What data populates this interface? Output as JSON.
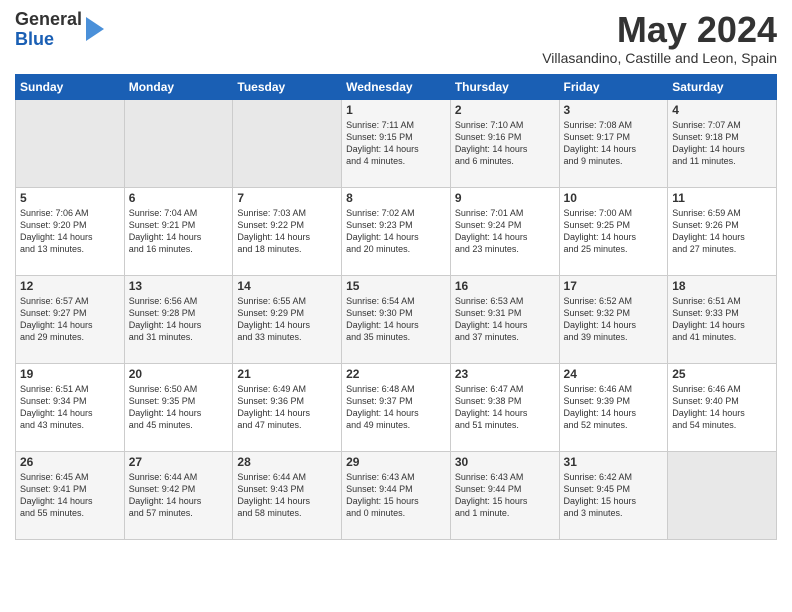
{
  "header": {
    "logo_general": "General",
    "logo_blue": "Blue",
    "title": "May 2024",
    "location": "Villasandino, Castille and Leon, Spain"
  },
  "weekdays": [
    "Sunday",
    "Monday",
    "Tuesday",
    "Wednesday",
    "Thursday",
    "Friday",
    "Saturday"
  ],
  "weeks": [
    [
      {
        "day": "",
        "content": ""
      },
      {
        "day": "",
        "content": ""
      },
      {
        "day": "",
        "content": ""
      },
      {
        "day": "1",
        "content": "Sunrise: 7:11 AM\nSunset: 9:15 PM\nDaylight: 14 hours\nand 4 minutes."
      },
      {
        "day": "2",
        "content": "Sunrise: 7:10 AM\nSunset: 9:16 PM\nDaylight: 14 hours\nand 6 minutes."
      },
      {
        "day": "3",
        "content": "Sunrise: 7:08 AM\nSunset: 9:17 PM\nDaylight: 14 hours\nand 9 minutes."
      },
      {
        "day": "4",
        "content": "Sunrise: 7:07 AM\nSunset: 9:18 PM\nDaylight: 14 hours\nand 11 minutes."
      }
    ],
    [
      {
        "day": "5",
        "content": "Sunrise: 7:06 AM\nSunset: 9:20 PM\nDaylight: 14 hours\nand 13 minutes."
      },
      {
        "day": "6",
        "content": "Sunrise: 7:04 AM\nSunset: 9:21 PM\nDaylight: 14 hours\nand 16 minutes."
      },
      {
        "day": "7",
        "content": "Sunrise: 7:03 AM\nSunset: 9:22 PM\nDaylight: 14 hours\nand 18 minutes."
      },
      {
        "day": "8",
        "content": "Sunrise: 7:02 AM\nSunset: 9:23 PM\nDaylight: 14 hours\nand 20 minutes."
      },
      {
        "day": "9",
        "content": "Sunrise: 7:01 AM\nSunset: 9:24 PM\nDaylight: 14 hours\nand 23 minutes."
      },
      {
        "day": "10",
        "content": "Sunrise: 7:00 AM\nSunset: 9:25 PM\nDaylight: 14 hours\nand 25 minutes."
      },
      {
        "day": "11",
        "content": "Sunrise: 6:59 AM\nSunset: 9:26 PM\nDaylight: 14 hours\nand 27 minutes."
      }
    ],
    [
      {
        "day": "12",
        "content": "Sunrise: 6:57 AM\nSunset: 9:27 PM\nDaylight: 14 hours\nand 29 minutes."
      },
      {
        "day": "13",
        "content": "Sunrise: 6:56 AM\nSunset: 9:28 PM\nDaylight: 14 hours\nand 31 minutes."
      },
      {
        "day": "14",
        "content": "Sunrise: 6:55 AM\nSunset: 9:29 PM\nDaylight: 14 hours\nand 33 minutes."
      },
      {
        "day": "15",
        "content": "Sunrise: 6:54 AM\nSunset: 9:30 PM\nDaylight: 14 hours\nand 35 minutes."
      },
      {
        "day": "16",
        "content": "Sunrise: 6:53 AM\nSunset: 9:31 PM\nDaylight: 14 hours\nand 37 minutes."
      },
      {
        "day": "17",
        "content": "Sunrise: 6:52 AM\nSunset: 9:32 PM\nDaylight: 14 hours\nand 39 minutes."
      },
      {
        "day": "18",
        "content": "Sunrise: 6:51 AM\nSunset: 9:33 PM\nDaylight: 14 hours\nand 41 minutes."
      }
    ],
    [
      {
        "day": "19",
        "content": "Sunrise: 6:51 AM\nSunset: 9:34 PM\nDaylight: 14 hours\nand 43 minutes."
      },
      {
        "day": "20",
        "content": "Sunrise: 6:50 AM\nSunset: 9:35 PM\nDaylight: 14 hours\nand 45 minutes."
      },
      {
        "day": "21",
        "content": "Sunrise: 6:49 AM\nSunset: 9:36 PM\nDaylight: 14 hours\nand 47 minutes."
      },
      {
        "day": "22",
        "content": "Sunrise: 6:48 AM\nSunset: 9:37 PM\nDaylight: 14 hours\nand 49 minutes."
      },
      {
        "day": "23",
        "content": "Sunrise: 6:47 AM\nSunset: 9:38 PM\nDaylight: 14 hours\nand 51 minutes."
      },
      {
        "day": "24",
        "content": "Sunrise: 6:46 AM\nSunset: 9:39 PM\nDaylight: 14 hours\nand 52 minutes."
      },
      {
        "day": "25",
        "content": "Sunrise: 6:46 AM\nSunset: 9:40 PM\nDaylight: 14 hours\nand 54 minutes."
      }
    ],
    [
      {
        "day": "26",
        "content": "Sunrise: 6:45 AM\nSunset: 9:41 PM\nDaylight: 14 hours\nand 55 minutes."
      },
      {
        "day": "27",
        "content": "Sunrise: 6:44 AM\nSunset: 9:42 PM\nDaylight: 14 hours\nand 57 minutes."
      },
      {
        "day": "28",
        "content": "Sunrise: 6:44 AM\nSunset: 9:43 PM\nDaylight: 14 hours\nand 58 minutes."
      },
      {
        "day": "29",
        "content": "Sunrise: 6:43 AM\nSunset: 9:44 PM\nDaylight: 15 hours\nand 0 minutes."
      },
      {
        "day": "30",
        "content": "Sunrise: 6:43 AM\nSunset: 9:44 PM\nDaylight: 15 hours\nand 1 minute."
      },
      {
        "day": "31",
        "content": "Sunrise: 6:42 AM\nSunset: 9:45 PM\nDaylight: 15 hours\nand 3 minutes."
      },
      {
        "day": "",
        "content": ""
      }
    ]
  ]
}
